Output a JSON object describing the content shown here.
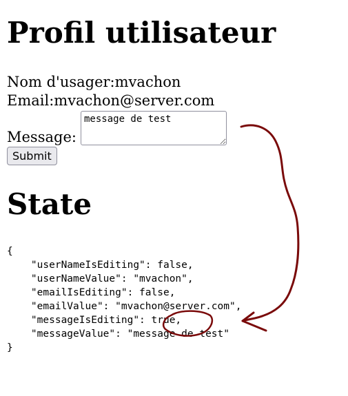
{
  "profile": {
    "title": "Profil utilisateur",
    "username_label": "Nom d'usager:",
    "username_value": "mvachon",
    "email_label": "Email:",
    "email_value": "mvachon@server.com",
    "message_label": "Message:",
    "message_value": "message de test",
    "submit_label": "Submit"
  },
  "state": {
    "title": "State",
    "json_text": "{\n    \"userNameIsEditing\": false,\n    \"userNameValue\": \"mvachon\",\n    \"emailIsEditing\": false,\n    \"emailValue\": \"mvachon@server.com\",\n    \"messageIsEditing\": true,\n    \"messageValue\": \"message de test\"\n}"
  },
  "annotation": {
    "color": "#7a0a0a"
  }
}
